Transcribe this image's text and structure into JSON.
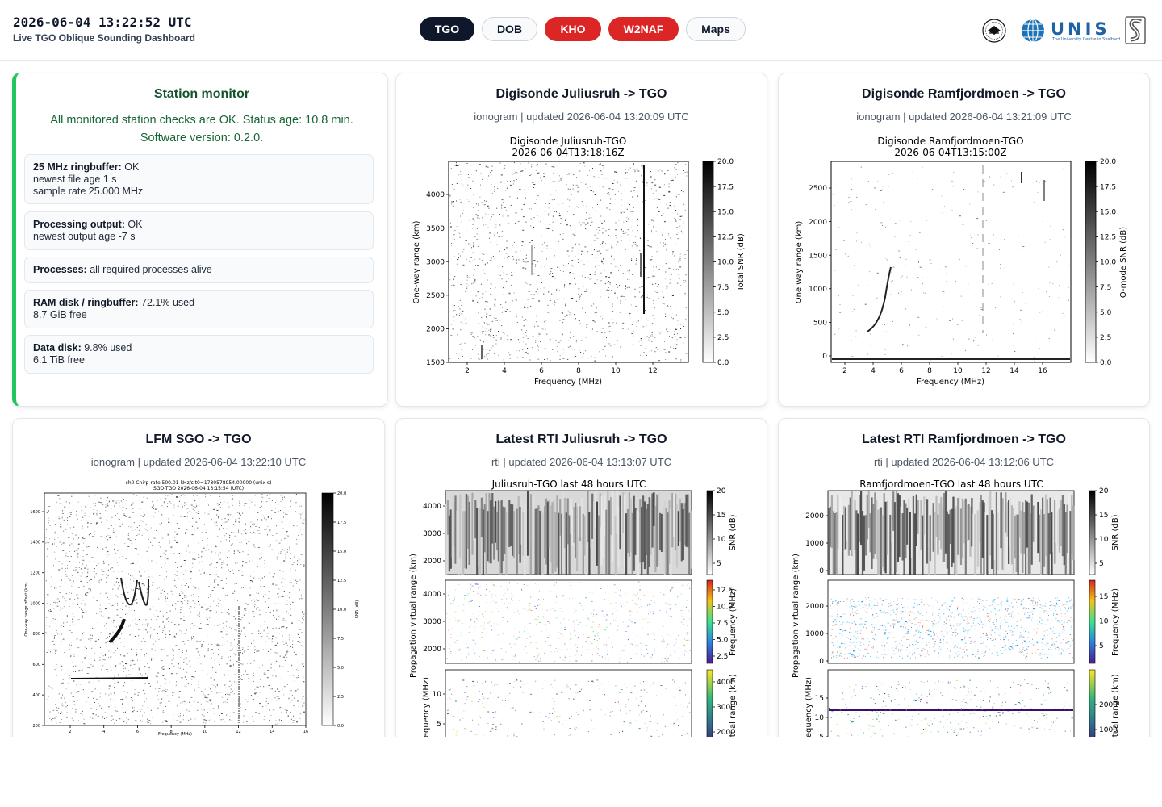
{
  "header": {
    "clock": "2026-06-04 13:22:52 UTC",
    "subtitle": "Live TGO Oblique Sounding Dashboard",
    "nav": [
      {
        "label": "TGO",
        "style": "dark"
      },
      {
        "label": "DOB",
        "style": "light"
      },
      {
        "label": "KHO",
        "style": "red"
      },
      {
        "label": "W2NAF",
        "style": "red"
      },
      {
        "label": "Maps",
        "style": "light"
      }
    ],
    "logos": {
      "unis_text": "UNIS",
      "unis_sub": "The University Centre in Svalbard"
    }
  },
  "colors": {
    "accent_green": "#22c55e",
    "dark": "#0f172a",
    "red": "#dc2626"
  },
  "monitor": {
    "title": "Station monitor",
    "summary_1": "All monitored station checks are OK. Status age: 10.8 min.",
    "summary_2": "Software version: 0.2.0.",
    "checks": [
      {
        "label": "25 MHz ringbuffer:",
        "value": "OK",
        "lines": [
          "newest file age 1 s",
          "sample rate 25.000 MHz"
        ]
      },
      {
        "label": "Processing output:",
        "value": "OK",
        "lines": [
          "newest output age -7 s"
        ]
      },
      {
        "label": "Processes:",
        "value": "all required processes alive",
        "lines": []
      },
      {
        "label": "RAM disk / ringbuffer:",
        "value": "72.1% used",
        "lines": [
          "8.7 GiB free"
        ]
      },
      {
        "label": "Data disk:",
        "value": "9.8% used",
        "lines": [
          "6.1 TiB free"
        ]
      }
    ]
  },
  "panels": {
    "jul": {
      "title": "Digisonde Juliusruh -> TGO",
      "meta": "ionogram | updated 2026-06-04 13:20:09 UTC",
      "plot_title": [
        "Digisonde Juliusruh-TGO",
        "2026-06-04T13:18:16Z"
      ],
      "xlabel": "Frequency (MHz)",
      "ylabel": "One-way range (km)",
      "cbar_label": "Total SNR (dB)",
      "xticks": [
        "2",
        "4",
        "6",
        "8",
        "10",
        "12"
      ],
      "yticks": [
        "1500",
        "2000",
        "2500",
        "3000",
        "3500",
        "4000"
      ],
      "cticks": [
        "0.0",
        "2.5",
        "5.0",
        "7.5",
        "10.0",
        "12.5",
        "15.0",
        "17.5",
        "20.0"
      ]
    },
    "ram": {
      "title": "Digisonde Ramfjordmoen -> TGO",
      "meta": "ionogram | updated 2026-06-04 13:21:09 UTC",
      "plot_title": [
        "Digisonde Ramfjordmoen-TGO",
        "2026-06-04T13:15:00Z"
      ],
      "xlabel": "Frequency (MHz)",
      "ylabel": "One way range (km)",
      "cbar_label": "O-mode SNR (dB)",
      "xticks": [
        "2",
        "4",
        "6",
        "8",
        "10",
        "12",
        "14",
        "16"
      ],
      "yticks": [
        "0",
        "500",
        "1000",
        "1500",
        "2000",
        "2500"
      ],
      "cticks": [
        "0.0",
        "2.5",
        "5.0",
        "7.5",
        "10.0",
        "12.5",
        "15.0",
        "17.5",
        "20.0"
      ]
    },
    "lfm": {
      "title": "LFM SGO -> TGO",
      "meta": "ionogram | updated 2026-06-04 13:22:10 UTC",
      "plot_title": [
        "ch0 Chirp-rate 500.01 kHz/s t0=1780578954.00000 (unix s)",
        "SGO-TGO 2026-06-04 13:15:54 (UTC)"
      ],
      "xlabel": "Frequency (MHz)",
      "ylabel": "One-way range offset (km)",
      "cbar_label": "SNR (dB)",
      "xticks": [
        "2",
        "4",
        "6",
        "8",
        "10",
        "12",
        "14",
        "16"
      ],
      "yticks": [
        "200",
        "400",
        "600",
        "800",
        "1000",
        "1200",
        "1400",
        "1600"
      ],
      "cticks": [
        "0.0",
        "2.5",
        "5.0",
        "7.5",
        "10.0",
        "12.5",
        "15.0",
        "17.5",
        "20.0"
      ]
    },
    "rtijul": {
      "title": "Latest RTI Juliusruh -> TGO",
      "meta": "rti | updated 2026-06-04 13:13:07 UTC",
      "plot_title": "Juliusruh-TGO last 48 hours UTC",
      "ylabel_1": "Propagation virtual range (km)",
      "ylabel_3": "Frequency (MHz)",
      "y1": [
        "2000",
        "3000",
        "4000"
      ],
      "y2": [
        "2000",
        "3000",
        "4000"
      ],
      "y3": [
        "5",
        "10"
      ],
      "c1_label": "SNR (dB)",
      "c1": [
        "5",
        "10",
        "15",
        "20"
      ],
      "c2_label": "Frequency (MHz)",
      "c2": [
        "2.5",
        "5.0",
        "7.5",
        "10.0",
        "12.5"
      ],
      "c3_label": "Virtual range (km)",
      "c3": [
        "2000",
        "3000",
        "4000"
      ]
    },
    "rtiram": {
      "title": "Latest RTI Ramfjordmoen -> TGO",
      "meta": "rti | updated 2026-06-04 13:12:06 UTC",
      "plot_title": "Ramfjordmoen-TGO last 48 hours UTC",
      "ylabel_1": "Propagation virtual range (km)",
      "ylabel_3": "Frequency (MHz)",
      "y1": [
        "0",
        "1000",
        "2000"
      ],
      "y2": [
        "0",
        "1000",
        "2000"
      ],
      "y3": [
        "5",
        "10",
        "15"
      ],
      "c1_label": "SNR (dB)",
      "c1": [
        "5",
        "10",
        "15",
        "20"
      ],
      "c2_label": "Frequency (MHz)",
      "c2": [
        "5",
        "10",
        "15"
      ],
      "c3_label": "Virtual range (km)",
      "c3": [
        "1000",
        "2000"
      ]
    }
  }
}
